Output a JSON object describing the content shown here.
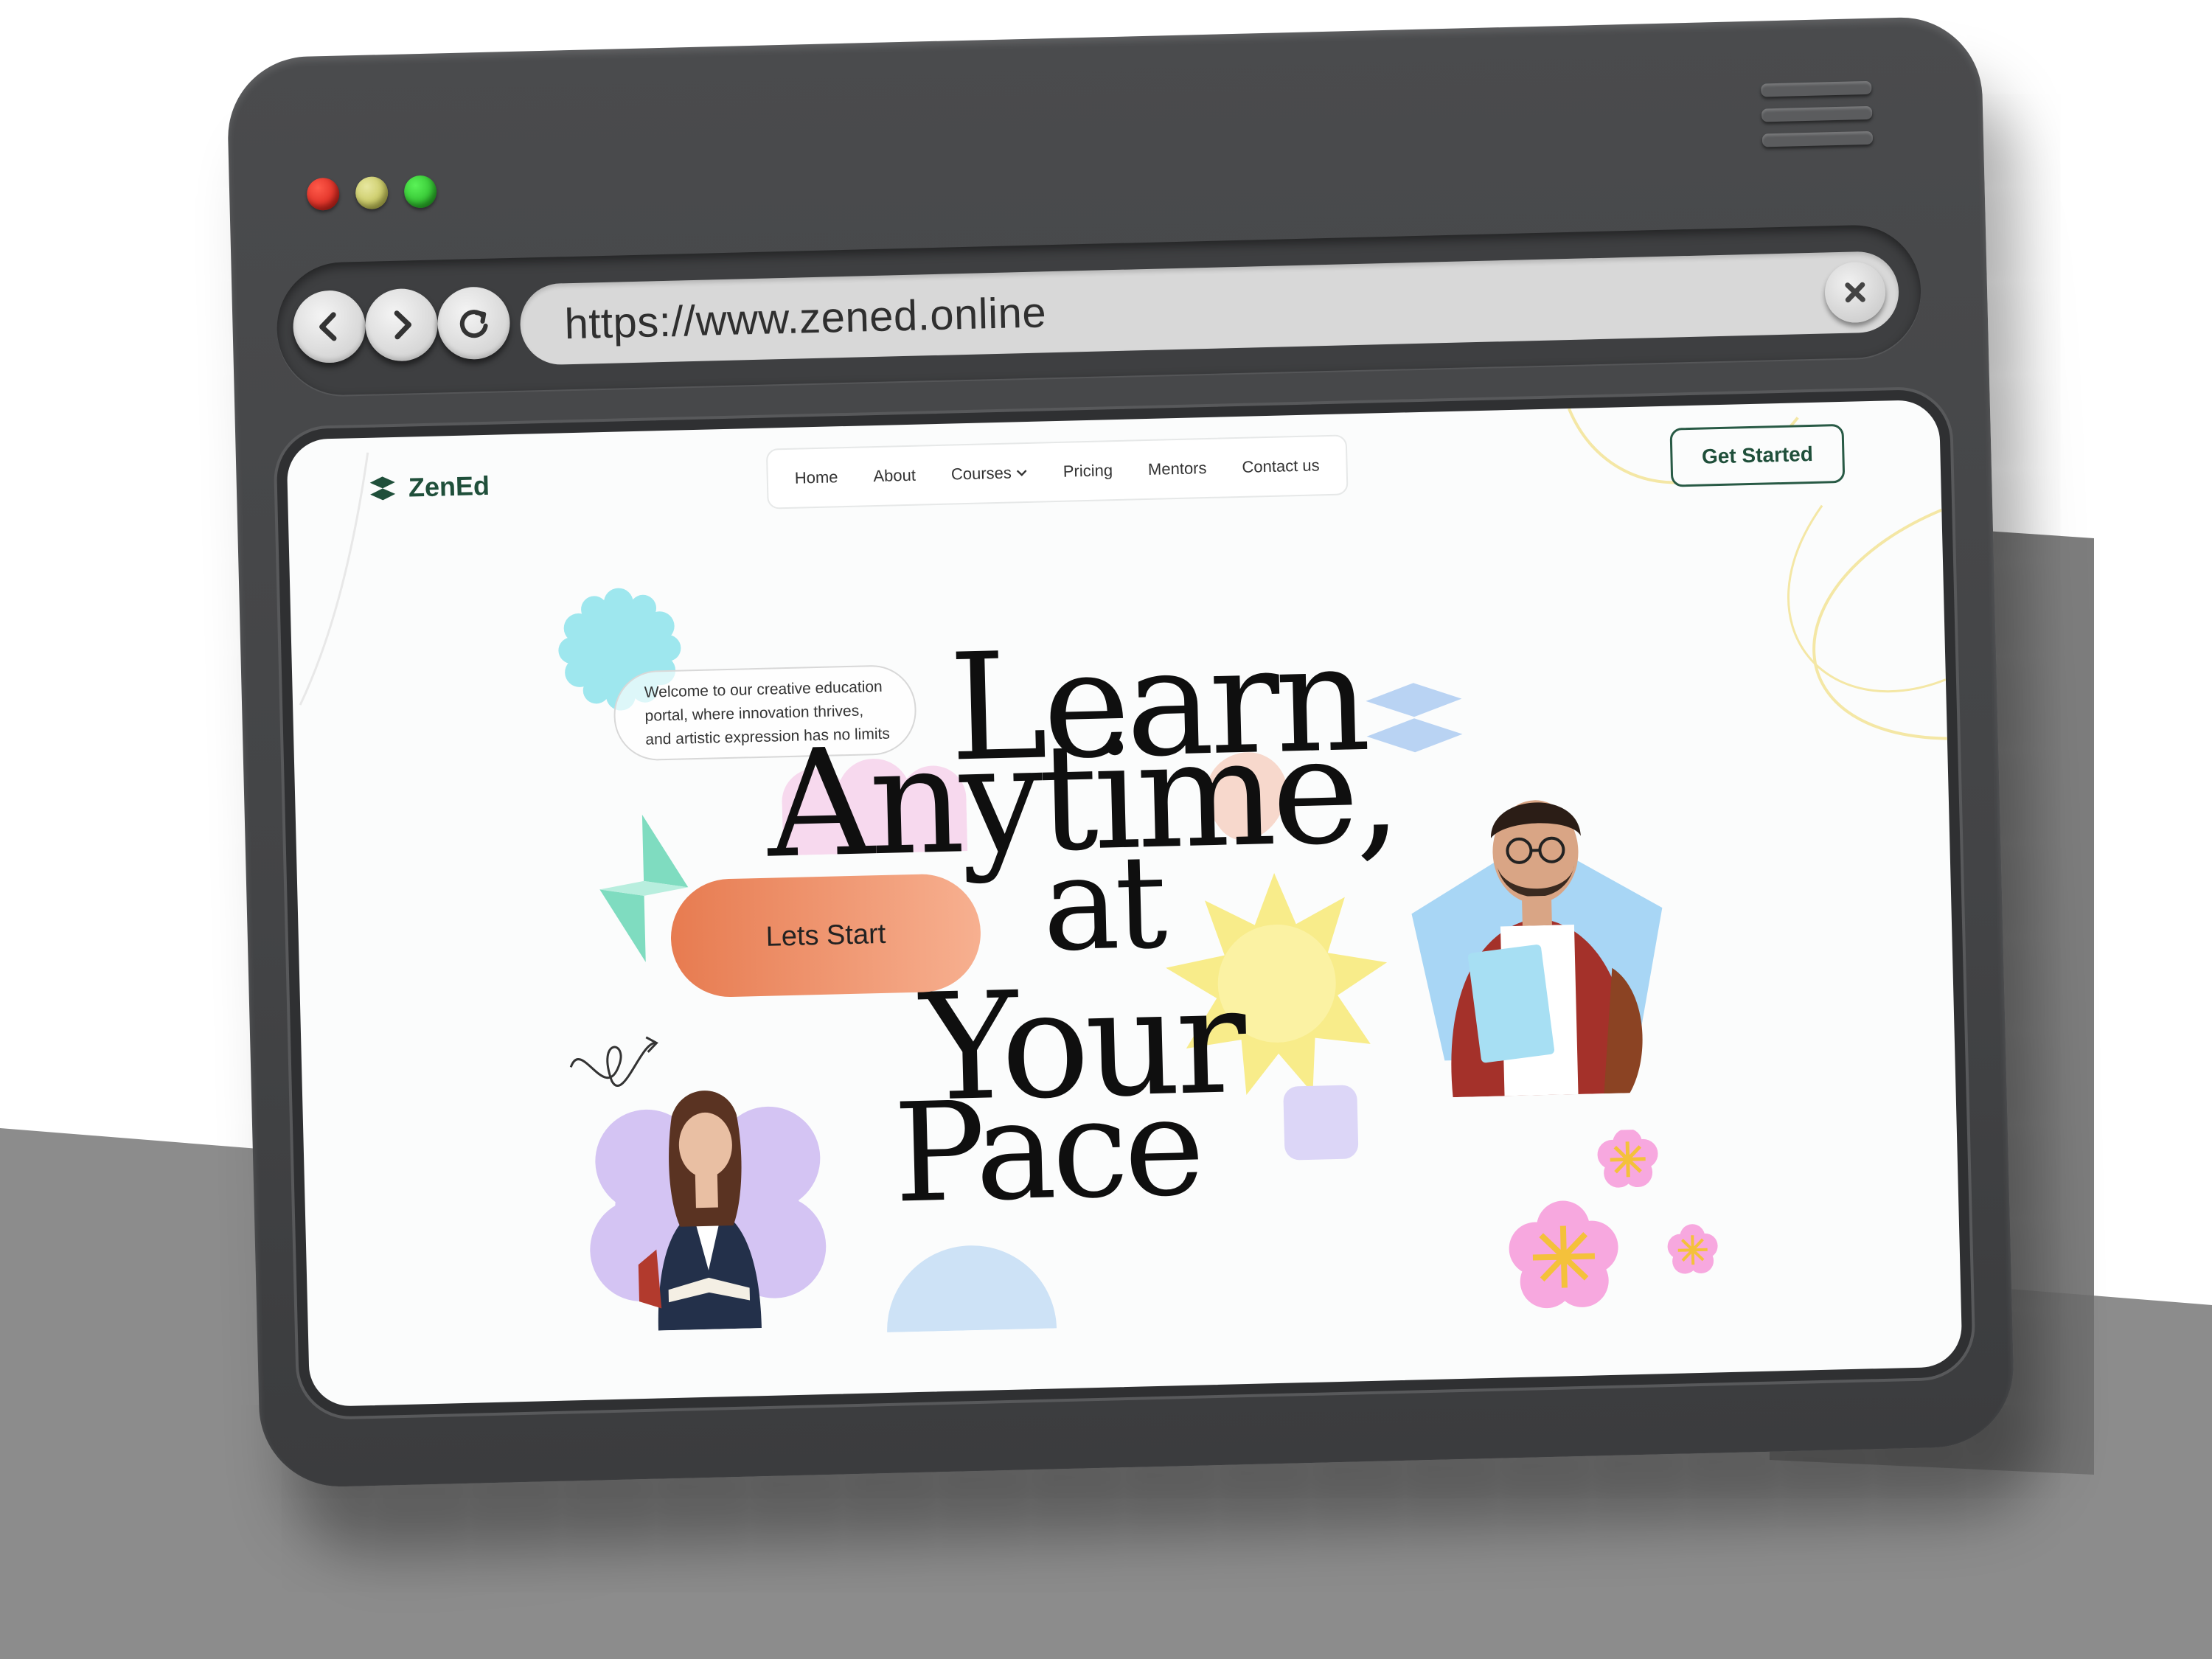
{
  "browser": {
    "url": "https://www.zened.online",
    "colors": {
      "frame": "#454648",
      "red": "#e01b10",
      "yellow": "#c9c95a",
      "green": "#2ac22a"
    }
  },
  "site": {
    "brand": "ZenEd",
    "nav": {
      "home": "Home",
      "about": "About",
      "courses": "Courses",
      "pricing": "Pricing",
      "mentors": "Mentors",
      "contact": "Contact us"
    },
    "cta": "Get Started",
    "welcome": "Welcome to our creative education portal, where innovation thrives, and artistic expression has no limits",
    "hero": {
      "line1": "Learn",
      "line2": "Anytime,",
      "line3": "at",
      "line4": "Your",
      "line5": "Pace"
    },
    "start_button": "Lets Start",
    "accent": "#1f4f3a"
  }
}
